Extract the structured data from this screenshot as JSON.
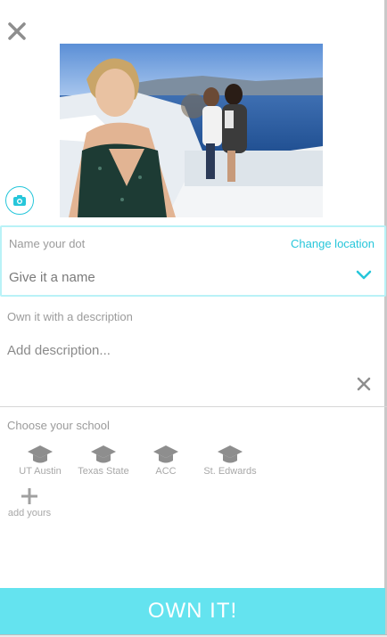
{
  "icons": {
    "close": "close-icon",
    "camera": "camera-icon",
    "chevron": "chevron-down-icon",
    "clear": "close-icon",
    "school": "graduation-cap-icon",
    "add": "plus-icon"
  },
  "colors": {
    "accent": "#26c6da",
    "button": "#64e3ef",
    "muted_text": "#9b9b9b",
    "icon_gray": "#8e8e8e"
  },
  "name_section": {
    "label": "Name your dot",
    "change_location": "Change location",
    "placeholder": "Give it a name"
  },
  "description_section": {
    "label": "Own it with a description",
    "placeholder": "Add description..."
  },
  "school_section": {
    "label": "Choose your school",
    "schools": [
      "UT Austin",
      "Texas State",
      "ACC",
      "St. Edwards"
    ],
    "add_label": "add yours"
  },
  "submit_label": "OWN IT!"
}
